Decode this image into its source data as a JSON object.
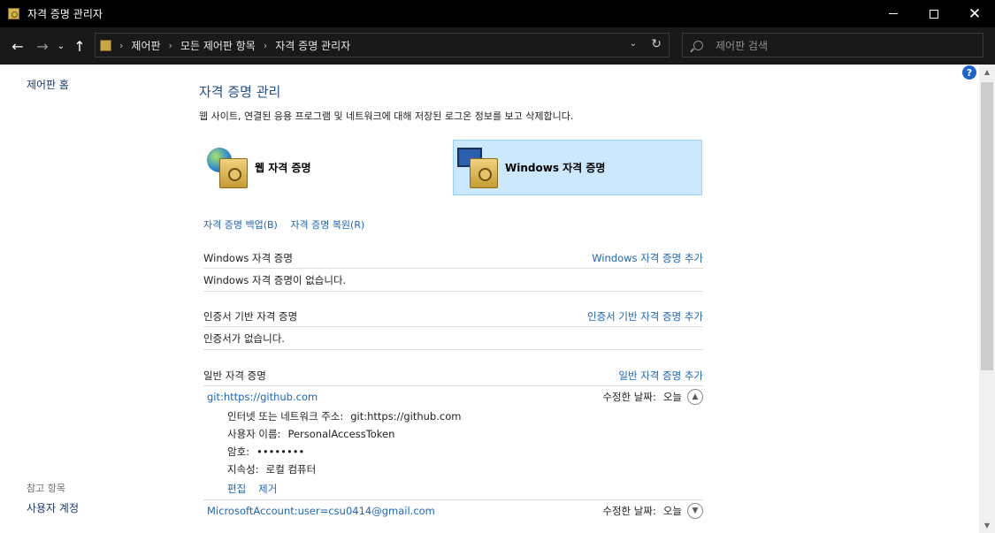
{
  "window": {
    "title": "자격 증명 관리자",
    "minimize_icon": "minimize-icon",
    "maximize_icon": "maximize-icon",
    "close_glyph": "✕"
  },
  "nav": {
    "back": "←",
    "forward": "→",
    "recent": "⌄",
    "up": "↑",
    "breadcrumb": [
      "제어판",
      "모든 제어판 항목",
      "자격 증명 관리자"
    ],
    "dropdown": "⌄",
    "refresh": "↻",
    "search_placeholder": "제어판 검색"
  },
  "sidebar": {
    "home": "제어판 홈",
    "see_also_title": "참고 항목",
    "see_also_link": "사용자 계정"
  },
  "main": {
    "title": "자격 증명 관리",
    "description": "웹 사이트, 연결된 응용 프로그램 및 네트워크에 대해 저장된 로그온 정보를 보고 삭제합니다.",
    "vaults": [
      {
        "label": "웹 자격 증명",
        "selected": false
      },
      {
        "label": "Windows 자격 증명",
        "selected": true
      }
    ],
    "backup_link": "자격 증명 백업(B)",
    "restore_link": "자격 증명 복원(R)",
    "sections": {
      "windows": {
        "title": "Windows 자격 증명",
        "add": "Windows 자격 증명 추가",
        "empty": "Windows 자격 증명이 없습니다."
      },
      "certificate": {
        "title": "인증서 기반 자격 증명",
        "add": "인증서 기반 자격 증명 추가",
        "empty": "인증서가 없습니다."
      },
      "generic": {
        "title": "일반 자격 증명",
        "add": "일반 자격 증명 추가",
        "items": [
          {
            "name": "git:https://github.com",
            "modified_label": "수정한 날짜:",
            "modified_value": "오늘",
            "expanded": true,
            "address_label": "인터넷 또는 네트워크 주소:",
            "address_value": "git:https://github.com",
            "user_label": "사용자 이름:",
            "user_value": "PersonalAccessToken",
            "password_label": "암호:",
            "password_value": "••••••••",
            "persistence_label": "지속성:",
            "persistence_value": "로컬 컴퓨터",
            "edit": "편집",
            "remove": "제거"
          },
          {
            "name": "MicrosoftAccount:user=csu0414@gmail.com",
            "modified_label": "수정한 날짜:",
            "modified_value": "오늘",
            "expanded": false
          }
        ]
      }
    }
  },
  "help": "?",
  "colors": {
    "link": "#1a66b8",
    "title": "#1e4e8c",
    "selected_bg": "#cce8ff",
    "titlebar": "#000000"
  }
}
